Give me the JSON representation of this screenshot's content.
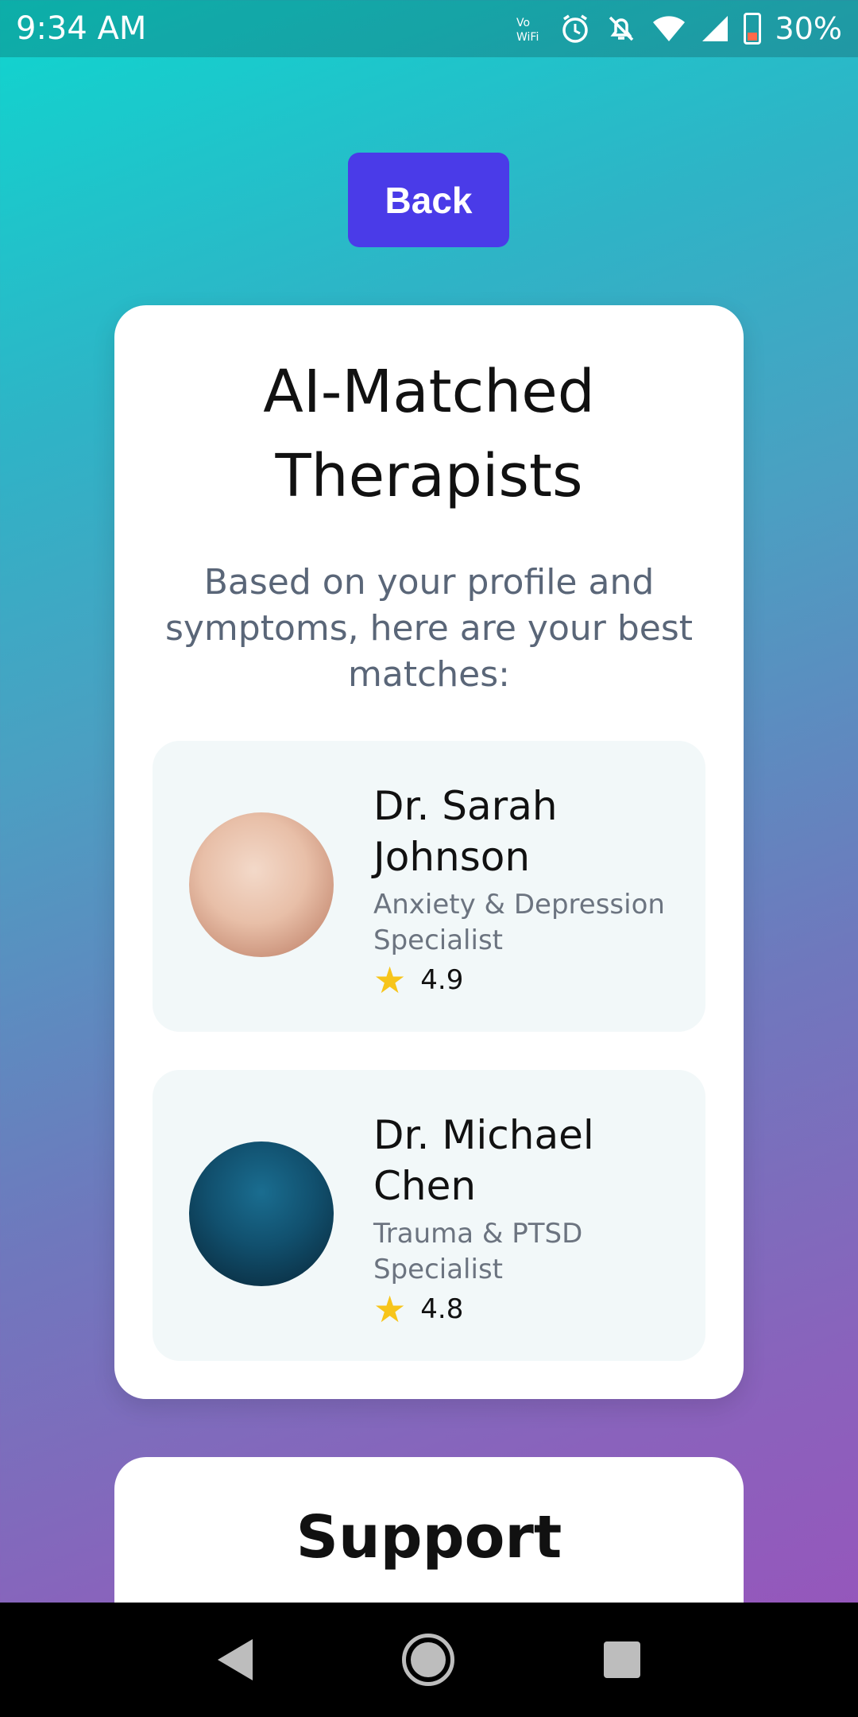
{
  "status_bar": {
    "time": "9:34 AM",
    "battery": "30%",
    "icons": [
      "vowifi-icon",
      "alarm-icon",
      "notifications-off-icon",
      "wifi-icon",
      "signal-icon",
      "battery-icon"
    ]
  },
  "back_button": {
    "label": "Back"
  },
  "matches_card": {
    "title_line1": "AI-Matched",
    "title_line2": "Therapists",
    "subtitle": "Based on your profile and symptoms, here are your best matches:",
    "therapists": [
      {
        "name_line1": "Dr. Sarah",
        "name_line2": "Johnson",
        "specialty_line1": "Anxiety & Depression",
        "specialty_line2": "Specialist",
        "rating": "4.9"
      },
      {
        "name_line1": "Dr. Michael",
        "name_line2": "Chen",
        "specialty_line1": "Trauma & PTSD",
        "specialty_line2": "Specialist",
        "rating": "4.8"
      }
    ]
  },
  "support_card": {
    "title": "Support"
  },
  "colors": {
    "accent": "#4a3be8",
    "star": "#f7c51b",
    "gradient_top": "#0fd6cf",
    "gradient_bottom": "#9a52bb"
  }
}
